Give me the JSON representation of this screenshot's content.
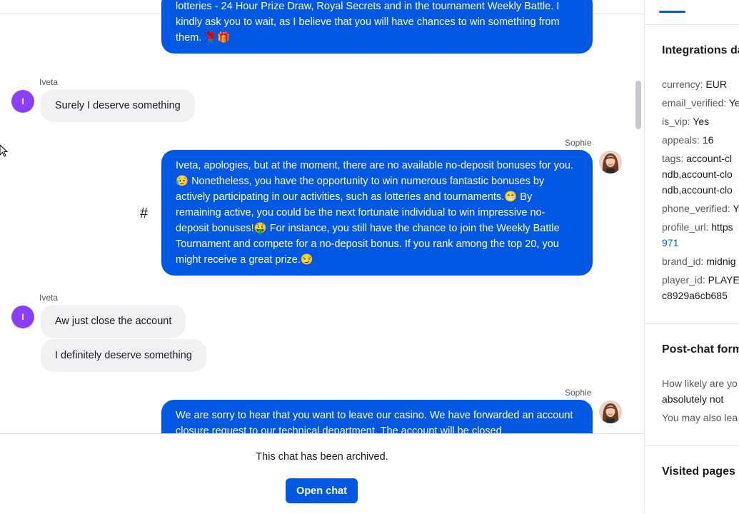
{
  "conversation": {
    "messages": [
      {
        "author": "",
        "text": "lotteries - 24 Hour Prize Draw, Royal Secrets and in the tournament Weekly Battle. I kindly ask you to wait, as I believe that you will have chances to win something from them. 🌹🎁"
      },
      {
        "author": "Iveta",
        "text": "Surely I deserve something"
      },
      {
        "author": "Sophie",
        "text": "Iveta, apologies, but at the moment, there are no available no-deposit bonuses for you.😥 Nonetheless, you have the opportunity to win numerous fantastic bonuses by actively participating in our activities, such as lotteries and tournaments.😁 By remaining active, you could be the next fortunate individual to win impressive no-deposit bonuses!🤑 For instance, you still have the chance to join the Weekly Battle Tournament and compete for a no-deposit bonus. If you rank among the top 20, you might receive a great prize.😏"
      },
      {
        "author": "Iveta",
        "text": "Aw just close the account"
      },
      {
        "author": "",
        "text": "I definitely deserve something"
      },
      {
        "author": "Sophie",
        "text": "We are sorry to hear that you want to leave our casino. We have forwarded an account closure request to our technical department. The account will be closed"
      }
    ],
    "customer_initial": "I",
    "hash_symbol": "#"
  },
  "footer": {
    "archived_text": "This chat has been archived.",
    "open_chat_label": "Open chat"
  },
  "sidebar": {
    "integrations_title": "Integrations da",
    "fields": [
      {
        "key": "currency:",
        "value": "EUR"
      },
      {
        "key": "email_verified:",
        "value": "Ye"
      },
      {
        "key": "is_vip:",
        "value": "Yes"
      },
      {
        "key": "appeals:",
        "value": "16"
      },
      {
        "key": "tags:",
        "value": "account-cl"
      },
      {
        "key": "phone_verified:",
        "value": "Y"
      },
      {
        "key": "profile_url:",
        "value": "https"
      },
      {
        "key": "brand_id:",
        "value": "midnig"
      },
      {
        "key": "player_id:",
        "value": "PLAYE"
      }
    ],
    "tags_line2": "ndb,account-clo",
    "tags_line3": "ndb,account-clo",
    "profile_url_line2": "971",
    "player_id_line2": "c8929a6cb685",
    "postchat_title": "Post-chat form",
    "postchat_question": "How likely are yo",
    "postchat_answer": "absolutely not",
    "postchat_more": "You may also lea",
    "visited_title": "Visited pages"
  }
}
